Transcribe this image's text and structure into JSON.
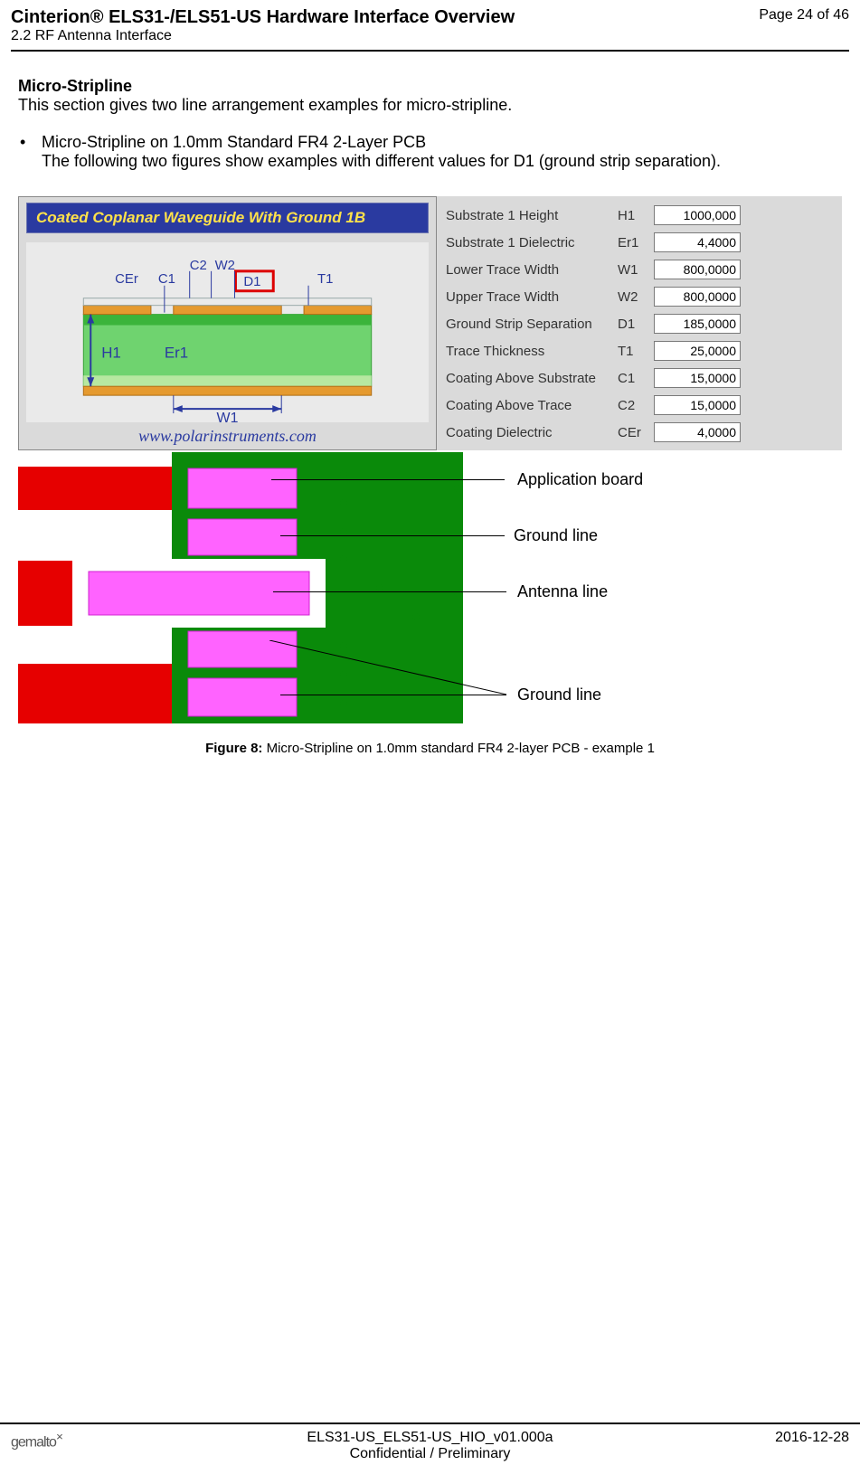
{
  "header": {
    "doc_title": "Cinterion® ELS31-/ELS51-US Hardware Interface Overview",
    "section": "2.2 RF Antenna Interface",
    "page": "Page 24 of 46"
  },
  "micro": {
    "title": "Micro-Stripline",
    "desc": "This section gives two line arrangement examples for micro-stripline.",
    "bullet_head": "Micro-Stripline on 1.0mm Standard FR4 2-Layer PCB",
    "bullet_body": "The following two figures show examples with different values for D1 (ground strip separation)."
  },
  "waveguide": {
    "title": "Coated Coplanar Waveguide With Ground 1B",
    "url": "www.polarinstruments.com",
    "labels": {
      "CEr": "CEr",
      "C1": "C1",
      "C2": "C2",
      "W2": "W2",
      "D1": "D1",
      "T1": "T1",
      "H1": "H1",
      "Er1": "Er1",
      "W1": "W1"
    }
  },
  "params": [
    {
      "label": "Substrate 1 Height",
      "sym": "H1",
      "val": "1000,000"
    },
    {
      "label": "Substrate 1 Dielectric",
      "sym": "Er1",
      "val": "4,4000"
    },
    {
      "label": "Lower Trace Width",
      "sym": "W1",
      "val": "800,0000"
    },
    {
      "label": "Upper Trace Width",
      "sym": "W2",
      "val": "800,0000"
    },
    {
      "label": "Ground Strip Separation",
      "sym": "D1",
      "val": "185,0000"
    },
    {
      "label": "Trace Thickness",
      "sym": "T1",
      "val": "25,0000"
    },
    {
      "label": "Coating Above Substrate",
      "sym": "C1",
      "val": "15,0000"
    },
    {
      "label": "Coating Above Trace",
      "sym": "C2",
      "val": "15,0000"
    },
    {
      "label": "Coating Dielectric",
      "sym": "CEr",
      "val": "4,0000"
    }
  ],
  "callouts": {
    "app_board": "Application board",
    "gnd1": "Ground line",
    "ant": "Antenna line",
    "gnd2": "Ground line"
  },
  "figure_caption": {
    "prefix": "Figure 8:",
    "text": " Micro-Stripline on 1.0mm standard FR4 2-layer PCB - example 1"
  },
  "footer": {
    "logo": "gemalto",
    "center1": "ELS31-US_ELS51-US_HIO_v01.000a",
    "center2": "Confidential / Preliminary",
    "date": "2016-12-28"
  }
}
